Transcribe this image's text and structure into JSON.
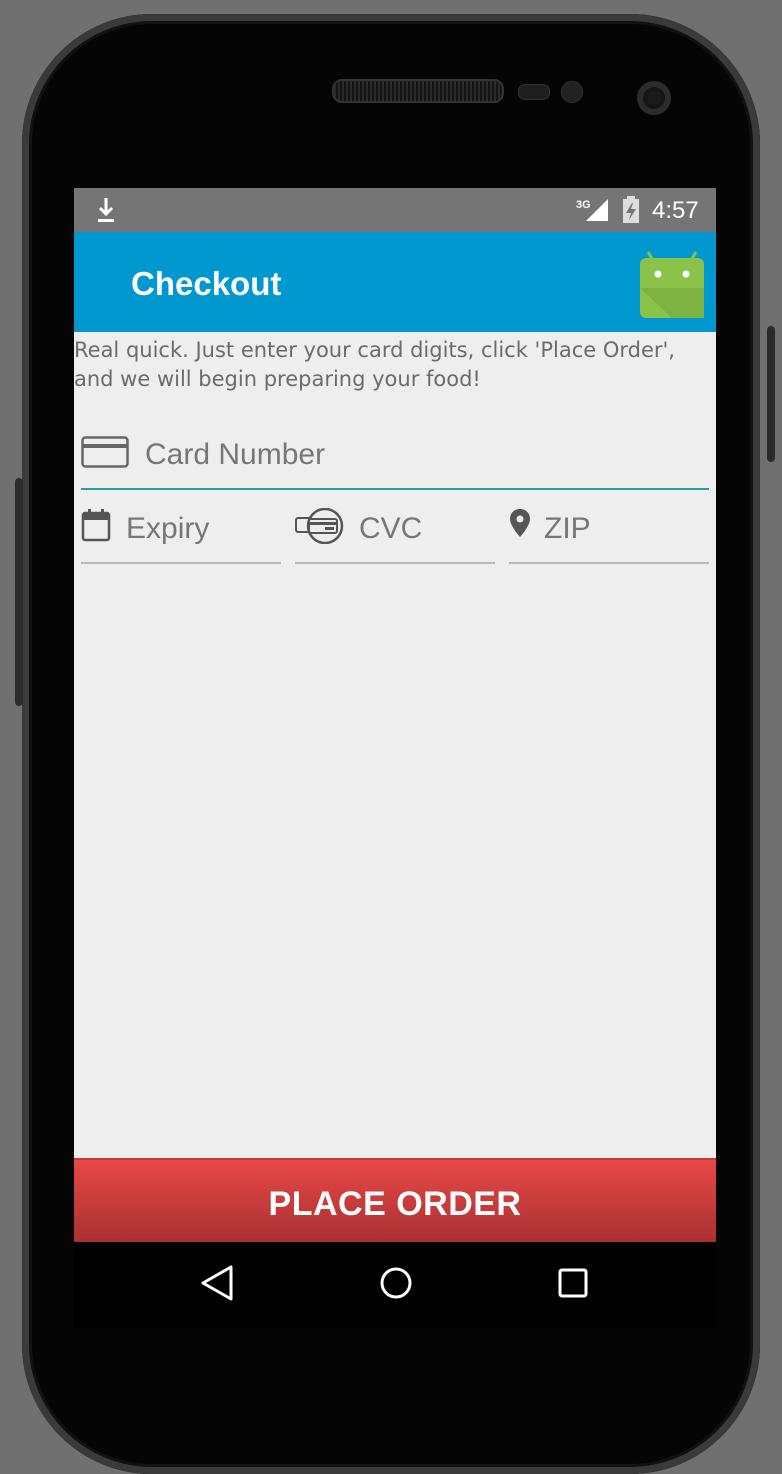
{
  "status_bar": {
    "time": "4:57",
    "network": "3G",
    "icons": [
      "download-icon",
      "signal-icon",
      "battery-charging-icon"
    ]
  },
  "app_bar": {
    "title": "Checkout",
    "logo": "android-logo"
  },
  "intro_text": "Real quick.  Just enter your card digits, click 'Place Order', and we will begin preparing your food!",
  "form": {
    "card_number": {
      "placeholder": "Card Number",
      "value": "",
      "icon": "credit-card-icon"
    },
    "expiry": {
      "placeholder": "Expiry",
      "value": "",
      "icon": "calendar-icon"
    },
    "cvc": {
      "placeholder": "CVC",
      "value": "",
      "icon": "card-cvc-icon"
    },
    "zip": {
      "placeholder": "ZIP",
      "value": "",
      "icon": "location-pin-icon"
    }
  },
  "place_order_label": "PLACE ORDER",
  "nav": {
    "back": "back-icon",
    "home": "home-icon",
    "recents": "recents-icon"
  },
  "colors": {
    "app_bar": "#0198d0",
    "status_bar": "#757575",
    "place_order": "#d94040",
    "focus_underline": "#2aa09a",
    "background": "#eeeeee"
  }
}
